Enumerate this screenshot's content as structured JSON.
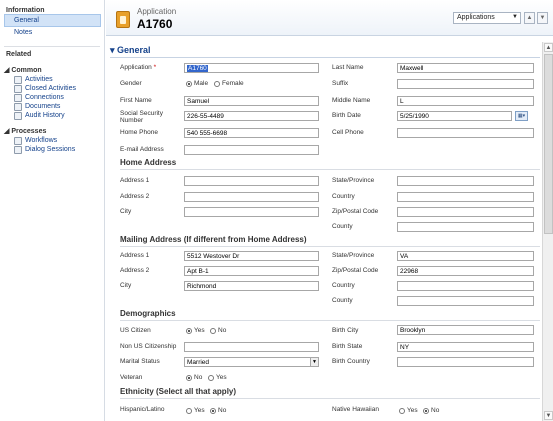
{
  "nav": {
    "information": "Information",
    "general": "General",
    "notes": "Notes",
    "related": "Related",
    "common": "Common",
    "common_items": [
      "Activities",
      "Closed Activities",
      "Connections",
      "Documents",
      "Audit History"
    ],
    "processes": "Processes",
    "process_items": [
      "Workflows",
      "Dialog Sessions"
    ]
  },
  "header": {
    "entity": "Application",
    "record": "A1760",
    "form_selector": "Applications",
    "prev": "▲",
    "next": "▼"
  },
  "section": {
    "title": "General"
  },
  "fields": {
    "application_label": "Application",
    "application_value": "A1760",
    "last_name_label": "Last Name",
    "last_name_value": "Maxwell",
    "gender_label": "Gender",
    "gender_male": "Male",
    "gender_female": "Female",
    "suffix_label": "Suffix",
    "first_name_label": "First Name",
    "first_name_value": "Samuel",
    "middle_name_label": "Middle Name",
    "middle_name_value": "L",
    "ssn_label": "Social Security Number",
    "ssn_value": "226-55-4489",
    "birth_date_label": "Birth Date",
    "birth_date_value": "5/25/1990",
    "home_phone_label": "Home Phone",
    "home_phone_value": "540 555-6698",
    "cell_phone_label": "Cell Phone",
    "email_label": "E-mail Address"
  },
  "home_address": {
    "title": "Home Address",
    "address1": "Address 1",
    "address2": "Address 2",
    "city": "City",
    "state": "State/Province",
    "country": "Country",
    "zip": "Zip/Postal Code",
    "county": "County"
  },
  "mailing_address": {
    "title": "Mailing Address (If different from Home Address)",
    "address1": "Address 1",
    "address1_value": "5512 Westover Dr",
    "address2": "Address 2",
    "address2_value": "Apt B-1",
    "city": "City",
    "city_value": "Richmond",
    "state": "State/Province",
    "state_value": "VA",
    "zip": "Zip/Postal Code",
    "zip_value": "22968",
    "country": "Country",
    "county": "County"
  },
  "demographics": {
    "title": "Demographics",
    "us_citizen": "US Citizen",
    "yes": "Yes",
    "no": "No",
    "non_us": "Non US Citizenship",
    "marital": "Marital Status",
    "marital_value": "Married",
    "veteran": "Veteran",
    "birth_city": "Birth City",
    "birth_city_value": "Brooklyn",
    "birth_state": "Birth State",
    "birth_state_value": "NY",
    "birth_country": "Birth Country"
  },
  "ethnicity": {
    "title": "Ethnicity (Select all that apply)",
    "hispanic": "Hispanic/Latino",
    "hawaiian": "Native Hawaiian",
    "yes": "Yes",
    "no": "No"
  }
}
